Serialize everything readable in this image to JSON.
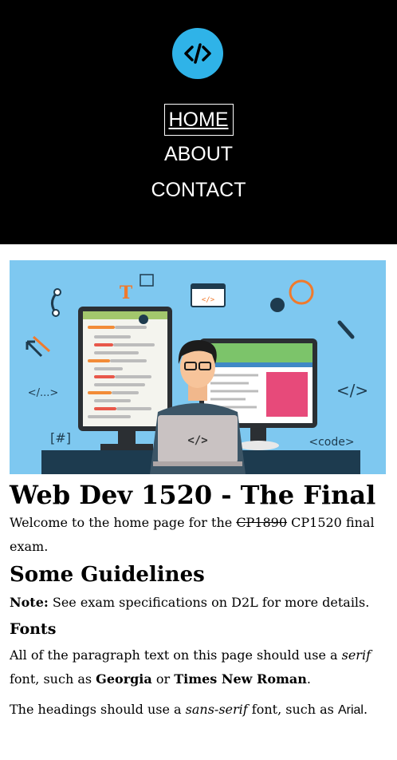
{
  "nav": {
    "items": [
      {
        "label": "HOME"
      },
      {
        "label": "ABOUT"
      },
      {
        "label": "CONTACT"
      }
    ]
  },
  "hero": {
    "labels": {
      "slash_tag": "</...>",
      "hash": "[#]",
      "code": "<code>",
      "code_close": "</>",
      "laptop_code": "</>"
    }
  },
  "main": {
    "title": "Web Dev 1520 - The Final",
    "intro": {
      "text_before": "Welcome to the home page for the ",
      "struck": "CP1890",
      "text_after": " CP1520 final exam."
    },
    "guidelines_heading": "Some Guidelines",
    "note": {
      "label": "Note:",
      "text": " See exam specifications on D2L for more details."
    },
    "fonts_heading": "Fonts",
    "fonts_p1": {
      "a": "All of the paragraph text on this page should use a ",
      "em": "serif",
      "b": " font, such as ",
      "font1": "Georgia",
      "c": " or ",
      "font2": "Times New Roman",
      "d": "."
    },
    "fonts_p2": {
      "a": "The headings should use a ",
      "em": "sans-serif",
      "b": " font, such as ",
      "font": "Arial",
      "c": "."
    }
  }
}
